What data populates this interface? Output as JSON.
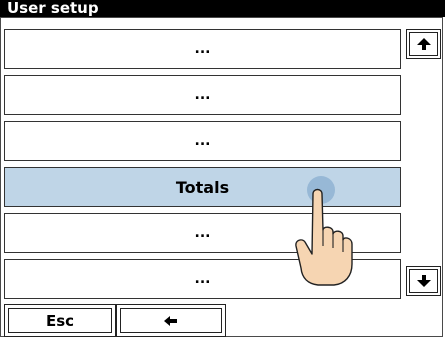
{
  "window": {
    "title": "User setup"
  },
  "list": {
    "items": [
      {
        "label": "..."
      },
      {
        "label": "..."
      },
      {
        "label": "..."
      },
      {
        "label": "Totals",
        "selected": true
      },
      {
        "label": "..."
      },
      {
        "label": "..."
      }
    ]
  },
  "scroll": {
    "up_icon": "arrow-up-icon",
    "down_icon": "arrow-down-icon"
  },
  "footer": {
    "esc_label": "Esc",
    "back_icon": "arrow-left-icon"
  },
  "colors": {
    "title_bg": "#000000",
    "selected_row": "#bfd5e7",
    "touch_point": "#8fb3d2",
    "hand_skin": "#f6d5b2"
  }
}
